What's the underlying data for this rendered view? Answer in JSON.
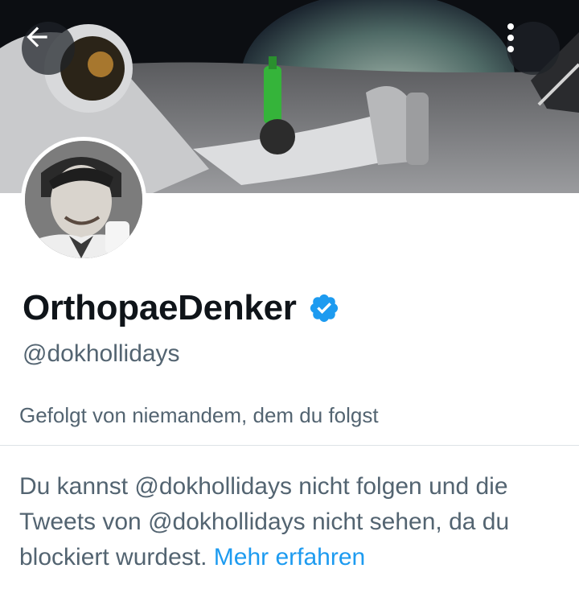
{
  "header": {
    "back_icon": "arrow-left-icon",
    "more_icon": "more-vertical-icon"
  },
  "profile": {
    "display_name": "OrthopaeDenker",
    "verified_icon": "verified-badge-icon",
    "verified_color": "#1d9bf0",
    "handle": "@dokhollidays",
    "followers_you_know": "Gefolgt von niemandem, dem du folgst"
  },
  "blocked_notice": {
    "text": "Du kannst @dokhollidays nicht folgen und die Tweets von @dokhollidays nicht sehen, da du blockiert wurdest.",
    "link_label": "Mehr erfahren",
    "link_color": "#1d9bf0"
  }
}
